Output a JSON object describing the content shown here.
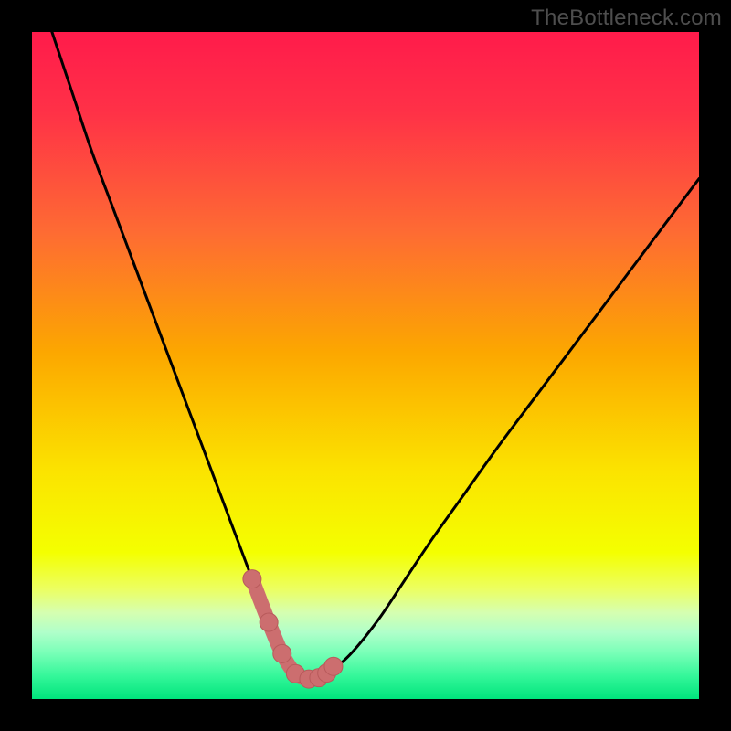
{
  "watermark": "TheBottleneck.com",
  "colors": {
    "frame": "#000000",
    "curve": "#000000",
    "marker_fill": "#cc6e6f",
    "marker_stroke": "#b85a5b",
    "gradient_stops": [
      {
        "offset": 0.0,
        "color": "#ff1b4b"
      },
      {
        "offset": 0.12,
        "color": "#ff3147"
      },
      {
        "offset": 0.3,
        "color": "#fe6b33"
      },
      {
        "offset": 0.48,
        "color": "#fca700"
      },
      {
        "offset": 0.66,
        "color": "#fbe400"
      },
      {
        "offset": 0.78,
        "color": "#f4ff00"
      },
      {
        "offset": 0.835,
        "color": "#ecff61"
      },
      {
        "offset": 0.87,
        "color": "#d6ffb0"
      },
      {
        "offset": 0.9,
        "color": "#b0ffca"
      },
      {
        "offset": 0.93,
        "color": "#7affb8"
      },
      {
        "offset": 0.965,
        "color": "#35f79a"
      },
      {
        "offset": 1.0,
        "color": "#00e47c"
      }
    ]
  },
  "chart_data": {
    "type": "line",
    "title": "",
    "xlabel": "",
    "ylabel": "",
    "xlim": [
      0,
      100
    ],
    "ylim": [
      0,
      100
    ],
    "grid": false,
    "series": [
      {
        "name": "bottleneck-curve",
        "x": [
          3,
          6,
          9,
          12,
          15,
          18,
          21,
          24,
          27,
          30,
          31.5,
          33,
          34.5,
          36,
          37,
          38,
          39,
          40,
          41.5,
          43,
          45,
          48,
          52,
          56,
          60,
          65,
          70,
          76,
          82,
          88,
          94,
          100
        ],
        "y": [
          100,
          91,
          82,
          74,
          66,
          58,
          50,
          42,
          34,
          26,
          22,
          18,
          14,
          10,
          7.5,
          5.5,
          4,
          3.3,
          3,
          3.2,
          4.3,
          7,
          12,
          18,
          24,
          31,
          38,
          46,
          54,
          62,
          70,
          78
        ]
      }
    ],
    "markers": {
      "name": "highlight-points",
      "x": [
        33.0,
        35.5,
        37.5,
        39.5,
        41.5,
        43.0,
        44.2,
        45.2
      ],
      "y": [
        18.0,
        11.5,
        6.8,
        3.8,
        3.0,
        3.2,
        3.9,
        4.9
      ],
      "r": 10
    },
    "marker_connector": {
      "x": [
        33.0,
        35.5,
        37.5,
        39.5,
        41.5,
        43.0,
        44.2,
        45.2
      ],
      "y": [
        18.0,
        11.5,
        6.8,
        3.8,
        3.0,
        3.2,
        3.9,
        4.9
      ]
    }
  }
}
